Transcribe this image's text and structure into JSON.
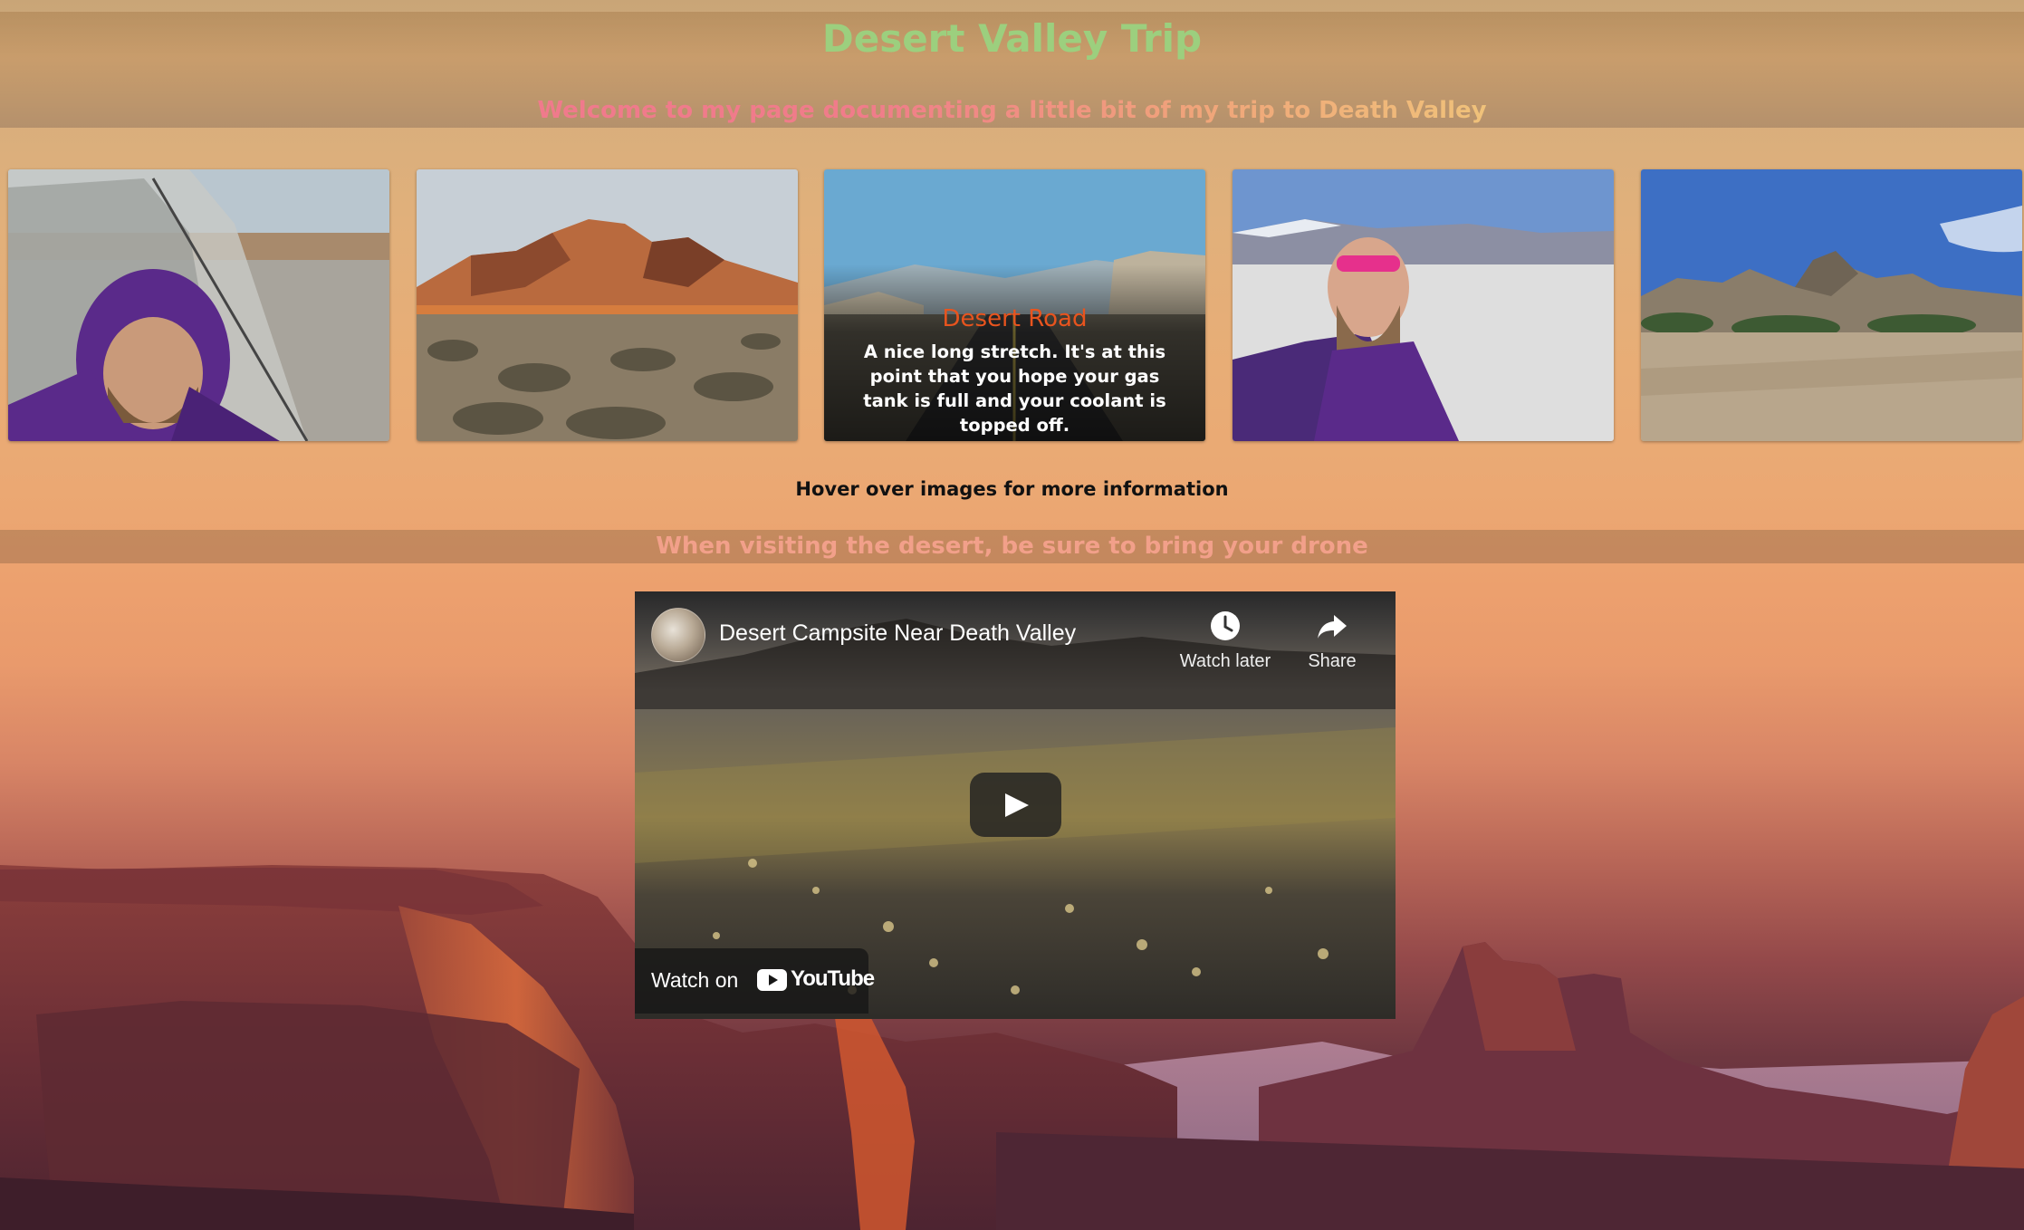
{
  "page": {
    "title": "Desert Valley Trip",
    "welcome": "Welcome to my page documenting a little bit of my trip to Death Valley",
    "hover_hint": "Hover over images for more information",
    "drone_heading": "When visiting the desert, be sure to bring your drone"
  },
  "gallery": {
    "cards": [
      {
        "id": "tent-selfie"
      },
      {
        "id": "mountain-sunset"
      },
      {
        "id": "desert-road",
        "caption_title": "Desert Road",
        "caption_text": "A nice long stretch. It's at this point that you hope your gas tank is full and your coolant is topped off."
      },
      {
        "id": "salt-flat-selfie"
      },
      {
        "id": "rock-formations"
      }
    ]
  },
  "video": {
    "title": "Desert Campsite Near Death Valley",
    "watch_later": "Watch later",
    "share": "Share",
    "watch_on": "Watch on",
    "youtube": "YouTube"
  },
  "colors": {
    "title": "#9ccf7e",
    "caption_title": "#e8541e",
    "drone_heading": "#f2a08a"
  }
}
